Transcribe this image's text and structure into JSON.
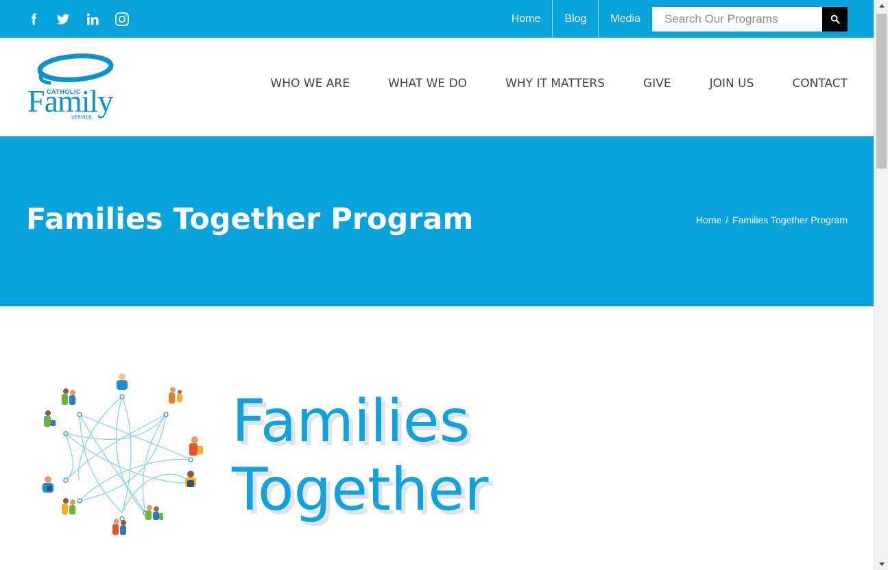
{
  "colors": {
    "brand_blue": "#08a3dd",
    "title_blue": "#0fa2de",
    "nav_text": "#444444",
    "search_button": "#000000"
  },
  "topbar": {
    "social": [
      {
        "icon": "facebook-icon"
      },
      {
        "icon": "twitter-icon"
      },
      {
        "icon": "linkedin-icon"
      },
      {
        "icon": "instagram-icon"
      }
    ],
    "links": [
      {
        "label": "Home"
      },
      {
        "label": "Blog"
      },
      {
        "label": "Media"
      }
    ],
    "search": {
      "placeholder": "Search Our Programs",
      "button_icon": "search-icon"
    }
  },
  "header": {
    "logo": {
      "top": "CATHOLIC",
      "main": "Family",
      "bottom": "SERVICE"
    },
    "nav": [
      {
        "label": "WHO WE ARE"
      },
      {
        "label": "WHAT WE DO"
      },
      {
        "label": "WHY IT MATTERS"
      },
      {
        "label": "GIVE"
      },
      {
        "label": "JOIN US"
      },
      {
        "label": "CONTACT"
      }
    ]
  },
  "titleband": {
    "title": "Families Together Program",
    "breadcrumb": {
      "home": "Home",
      "separator": "/",
      "current": "Families Together Program"
    }
  },
  "content": {
    "graphic_icon": "families-network-icon",
    "heading_line1": "Families",
    "heading_line2": "Together"
  }
}
